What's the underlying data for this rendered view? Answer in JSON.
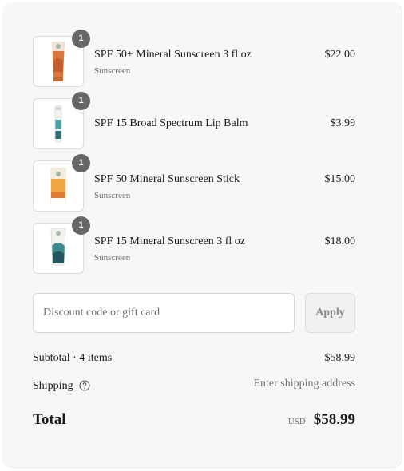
{
  "line_items": [
    {
      "quantity": "1",
      "name": "SPF 50+ Mineral Sunscreen 3 fl oz",
      "variant": "Sunscreen",
      "price": "$22.00",
      "image_icon": "orange-sunscreen-tube"
    },
    {
      "quantity": "1",
      "name": "SPF 15 Broad Spectrum Lip Balm",
      "variant": "",
      "price": "$3.99",
      "image_icon": "teal-lip-balm-tube"
    },
    {
      "quantity": "1",
      "name": "SPF 50 Mineral Sunscreen Stick",
      "variant": "Sunscreen",
      "price": "$15.00",
      "image_icon": "orange-sunscreen-stick"
    },
    {
      "quantity": "1",
      "name": "SPF 15 Mineral Sunscreen 3 fl oz",
      "variant": "Sunscreen",
      "price": "$18.00",
      "image_icon": "teal-sunscreen-tube"
    }
  ],
  "discount": {
    "placeholder": "Discount code or gift card",
    "value": "",
    "apply_label": "Apply"
  },
  "summary": {
    "subtotal_label": "Subtotal · 4 items",
    "subtotal_value": "$58.99",
    "shipping_label": "Shipping",
    "shipping_value": "Enter shipping address",
    "help_icon": "question-circle-icon",
    "total_label": "Total",
    "currency": "USD",
    "total_value": "$58.99"
  },
  "colors": {
    "panel_background": "#f7f7f7",
    "badge": "#666666",
    "text": "#1a1a1a",
    "muted_text": "#707070"
  }
}
